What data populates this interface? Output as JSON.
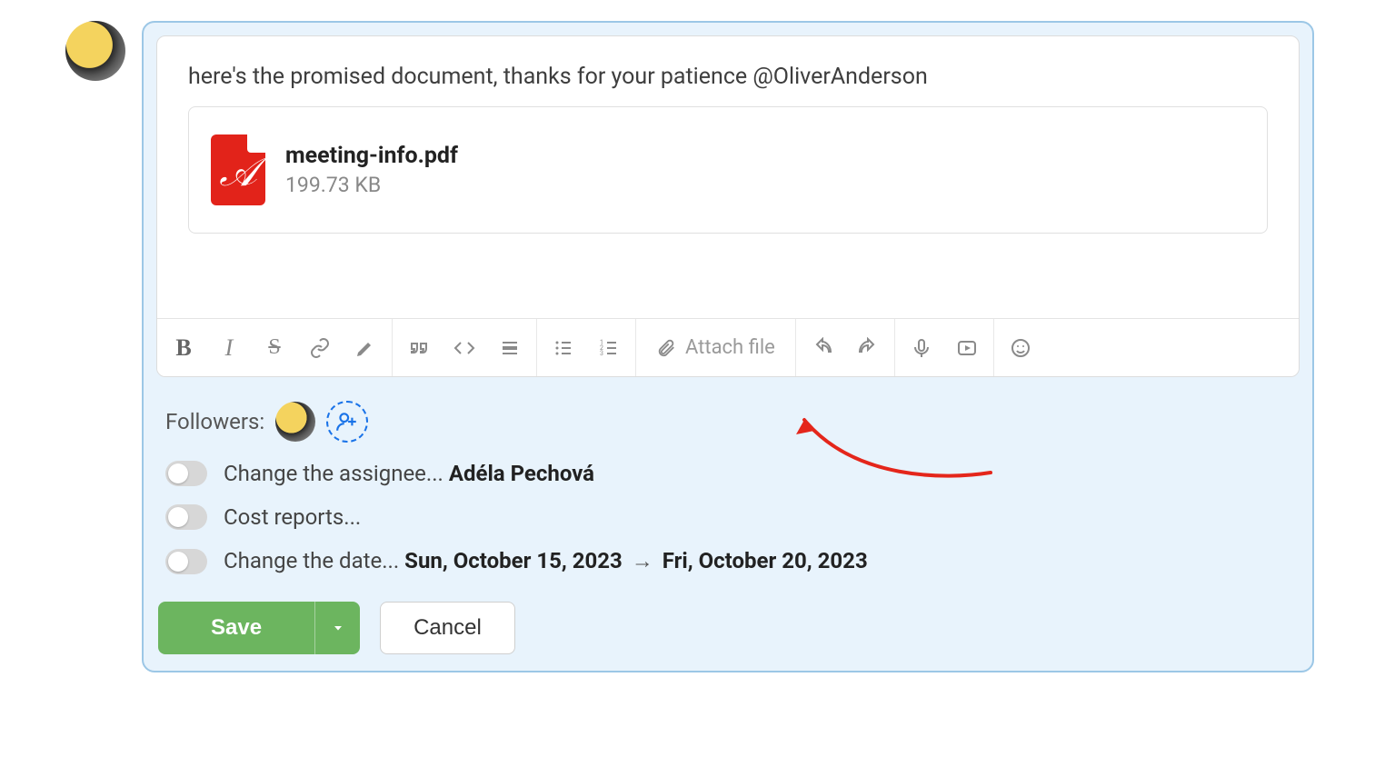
{
  "message": {
    "text": "here's the promised document, thanks for your patience @OliverAnderson",
    "attachment": {
      "filename": "meeting-info.pdf",
      "size": "199.73 KB"
    }
  },
  "toolbar": {
    "attach_label": "Attach file"
  },
  "followers": {
    "label": "Followers:"
  },
  "toggles": [
    {
      "prefix": "Change the assignee... ",
      "bold": "Adéla Pechová",
      "suffix": ""
    },
    {
      "prefix": "Cost reports...",
      "bold": "",
      "suffix": ""
    },
    {
      "prefix": "Change the date... ",
      "bold": "Sun, October 15, 2023",
      "arrow": " → ",
      "bold2": "Fri, October 20, 2023"
    }
  ],
  "buttons": {
    "save": "Save",
    "cancel": "Cancel"
  }
}
